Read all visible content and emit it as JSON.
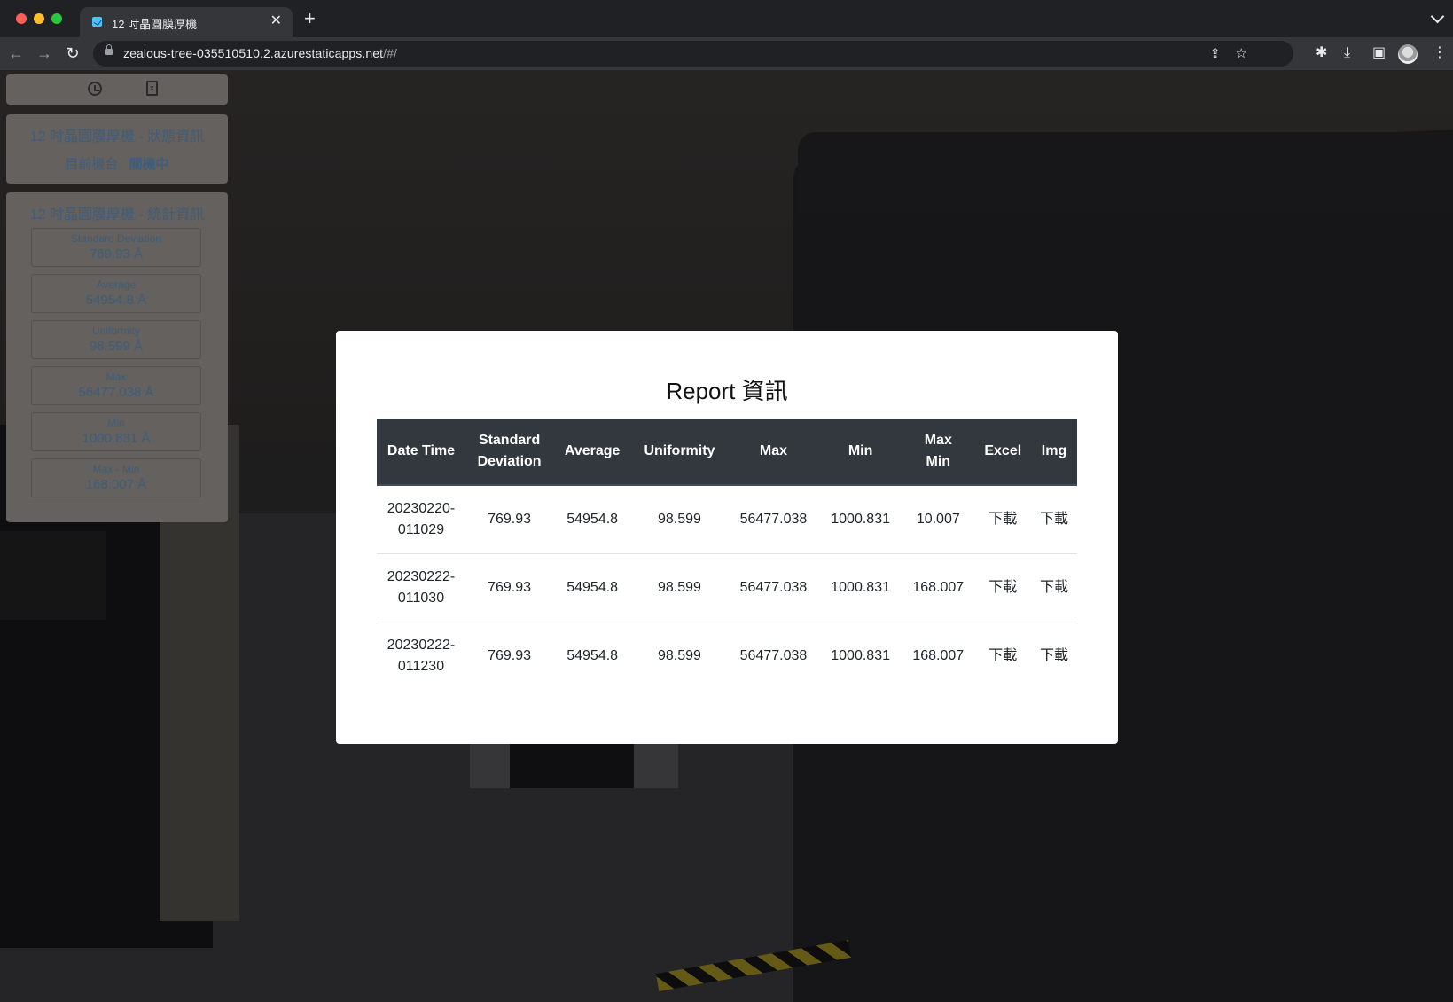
{
  "browser": {
    "tab_title": "12 吋晶圓膜厚機",
    "url_host": "zealous-tree-035510510.2.azurestaticapps.net",
    "url_path": "/#/"
  },
  "status_panel": {
    "title": "12 吋晶圓膜厚機 - 狀態資訊",
    "machine_label": "目前機台",
    "machine_state": "關機中"
  },
  "stats_panel": {
    "title": "12 吋晶圓膜厚機 - 統計資訊",
    "cards": [
      {
        "label": "Standard Deviation",
        "value": "769.93 Å"
      },
      {
        "label": "Average",
        "value": "54954.8 Å"
      },
      {
        "label": "Uniformity",
        "value": "98.599 Å"
      },
      {
        "label": "Max",
        "value": "56477.038 Å"
      },
      {
        "label": "Min",
        "value": "1000.831 Å"
      },
      {
        "label": "Max - Min",
        "value": "168.007 Å"
      }
    ]
  },
  "report": {
    "title": "Report 資訊",
    "columns": [
      "Date Time",
      "Standard\nDeviation",
      "Average",
      "Uniformity",
      "Max",
      "Min",
      "Max\nMin",
      "Excel",
      "Img"
    ],
    "rows": [
      {
        "datetime": "20230220-011029",
        "std": "769.93",
        "avg": "54954.8",
        "uniformity": "98.599",
        "max": "56477.038",
        "min": "1000.831",
        "maxmin": "10.007",
        "excel": "下載",
        "img": "下載"
      },
      {
        "datetime": "20230222-011030",
        "std": "769.93",
        "avg": "54954.8",
        "uniformity": "98.599",
        "max": "56477.038",
        "min": "1000.831",
        "maxmin": "168.007",
        "excel": "下載",
        "img": "下載"
      },
      {
        "datetime": "20230222-011230",
        "std": "769.93",
        "avg": "54954.8",
        "uniformity": "98.599",
        "max": "56477.038",
        "min": "1000.831",
        "maxmin": "168.007",
        "excel": "下載",
        "img": "下載"
      }
    ]
  }
}
